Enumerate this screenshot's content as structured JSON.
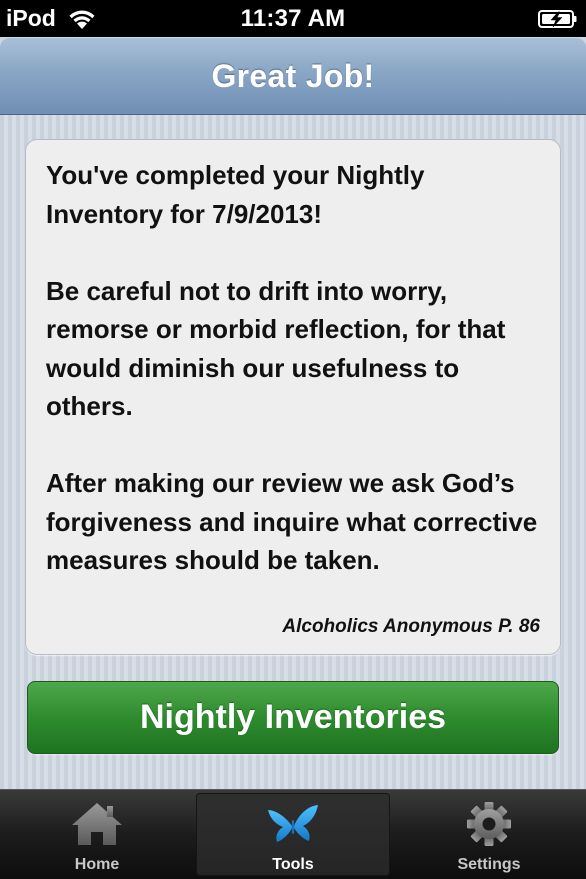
{
  "status_bar": {
    "carrier": "iPod",
    "time": "11:37 AM"
  },
  "nav_bar": {
    "title": "Great Job!"
  },
  "card": {
    "paragraph_1": "You've completed your Nightly Inventory for 7/9/2013!",
    "paragraph_2": "Be careful not to drift into worry, remorse or morbid reflection, for that would diminish our usefulness to others.",
    "paragraph_3": "After making our review we ask God’s forgiveness and inquire what corrective measures should be taken.",
    "attribution": "Alcoholics Anonymous P. 86"
  },
  "action_button": {
    "label": "Nightly Inventories"
  },
  "tab_bar": {
    "selected": "Tools",
    "tabs": [
      {
        "label": "Home",
        "icon": "home-icon"
      },
      {
        "label": "Tools",
        "icon": "butterfly-icon"
      },
      {
        "label": "Settings",
        "icon": "gear-icon"
      }
    ]
  },
  "colors": {
    "nav_bar": "#8aa6c5",
    "button_green": "#2e8b2e",
    "tools_icon_blue": "#1e9be0"
  }
}
